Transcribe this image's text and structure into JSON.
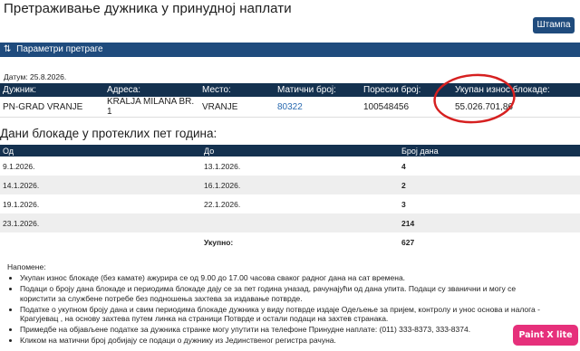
{
  "header": {
    "title": "Претраживање дужника у принудној наплати",
    "print_label": "Штампа"
  },
  "params": {
    "icon": "sort-icon",
    "label": "Параметри претраге"
  },
  "date_line": "Датум: 25.8.2026.",
  "debtor_table": {
    "headers": [
      "Дужник:",
      "Адреса:",
      "Место:",
      "Матични број:",
      "Порески број:",
      "Укупан износ блокаде:"
    ],
    "row": {
      "name": "PN-GRAD VRANJE",
      "address": "KRALJA MILANA BR. 1",
      "place": "VRANJE",
      "registry_number": "80322",
      "tax_number": "100548456",
      "total_amount": "55.026.701,86"
    }
  },
  "blockade": {
    "title": "Дани блокаде у протеклих пет година:",
    "headers": [
      "Од",
      "До",
      "Број дана"
    ],
    "rows": [
      {
        "from": "9.1.2026.",
        "to": "13.1.2026.",
        "days": "4"
      },
      {
        "from": "14.1.2026.",
        "to": "16.1.2026.",
        "days": "2"
      },
      {
        "from": "19.1.2026.",
        "to": "22.1.2026.",
        "days": "3"
      },
      {
        "from": "23.1.2026.",
        "to": "",
        "days": "214"
      }
    ],
    "total_label": "Укупно:",
    "total_value": "627"
  },
  "notes": {
    "title": "Напомене:",
    "items": [
      "Укупан износ блокаде (без камате) ажурира се од 9.00 до 17.00 часова сваког радног дана на сат времена.",
      "Подаци о броју дана блокаде и периодима блокаде дају се за пет година уназад, рачунајући од дана упита. Подаци су званични и могу се користити за службене потребе без подношења захтева за издавање потврде.",
      "Податке о укупном броју дана и свим периодима блокаде дужника у виду потврде издаје Одељење за пријем, контролу и унос основа и налога - Крагујевац , на основу захтева путем линка на страници Потврде и остали подаци на захтев странака.",
      "Примедбе на објављене податке за дужника странке могу упутити на телефоне Принудне наплате: (011) 333-8373, 333-8374.",
      "Кликом на матични број добијају се подаци о дужнику из Јединственог регистра рачуна."
    ]
  },
  "watermark": "Paint X lite",
  "colors": {
    "primary": "#1f4b7d",
    "table_header": "#14314f",
    "link": "#2a6ab0",
    "annotation": "#d62020",
    "watermark": "#e6307b"
  }
}
